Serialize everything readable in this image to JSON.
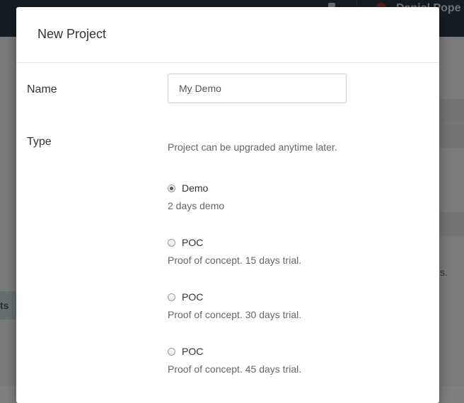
{
  "background": {
    "user_name": "Daniel Pope",
    "right_text": "s.",
    "left_tab_text": "ts"
  },
  "modal": {
    "title": "New Project",
    "name_label": "Name",
    "name_value": "My Demo",
    "type_label": "Type",
    "type_hint": "Project can be upgraded anytime later.",
    "options": [
      {
        "label": "Demo",
        "description": "2 days demo",
        "selected": true
      },
      {
        "label": "POC",
        "description": "Proof of concept. 15 days trial.",
        "selected": false
      },
      {
        "label": "POC",
        "description": "Proof of concept. 30 days trial.",
        "selected": false
      },
      {
        "label": "POC",
        "description": "Proof of concept. 45 days trial.",
        "selected": false
      }
    ]
  }
}
